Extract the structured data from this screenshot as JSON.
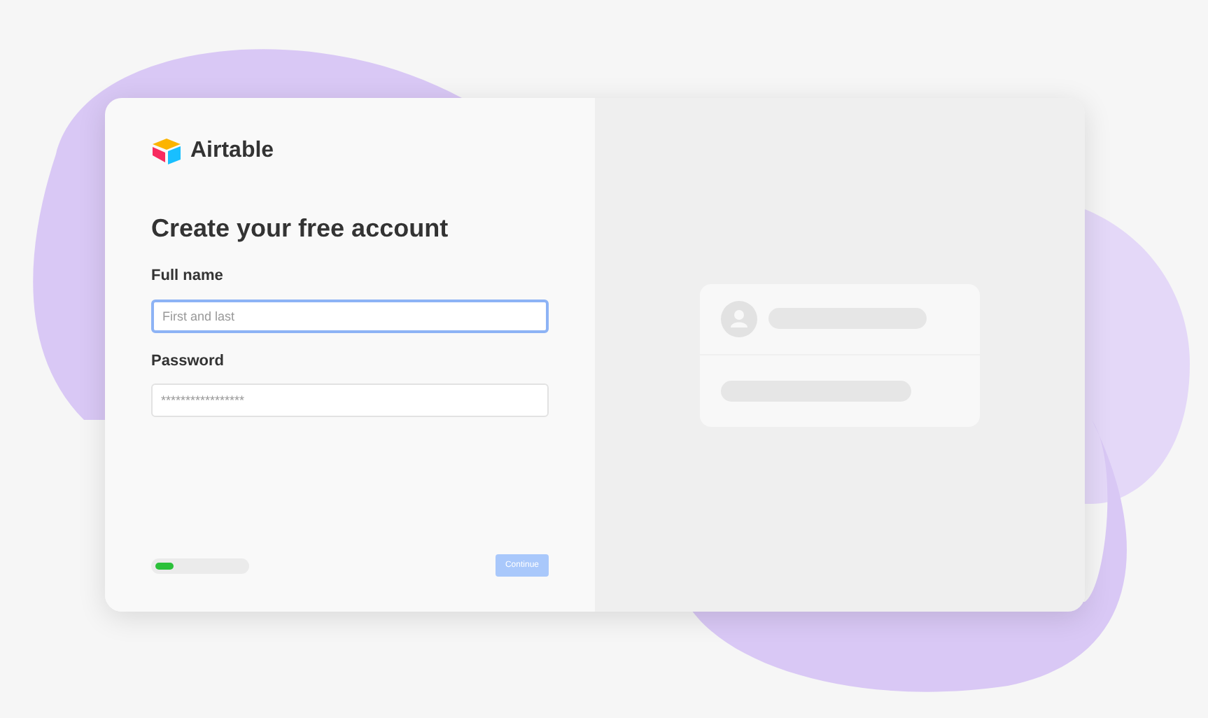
{
  "logo": {
    "text": "Airtable"
  },
  "heading": "Create your free account",
  "fields": [
    {
      "label": "Full name",
      "placeholder": "First and last",
      "focused": true
    },
    {
      "label": "Password",
      "placeholder": "*****************",
      "focused": false
    }
  ],
  "progress": {
    "level": 0.2
  },
  "continue_button": {
    "label": "Continue",
    "disabled": true
  }
}
